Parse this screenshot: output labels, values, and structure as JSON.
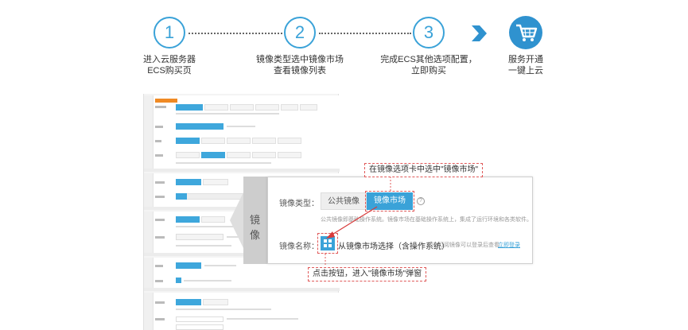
{
  "steps": [
    {
      "number": "1",
      "line1": "进入云服务器",
      "line2": "ECS购买页"
    },
    {
      "number": "2",
      "line1": "镜像类型选中镜像市场",
      "line2": "查看镜像列表"
    },
    {
      "number": "3",
      "line1": "完成ECS其他选项配置，",
      "line2": "立即购买"
    },
    {
      "number": "",
      "line1": "服务开通",
      "line2": "一键上云",
      "icon": "shopping-cart-icon"
    }
  ],
  "accent_color": "#3aa2d8",
  "callout": {
    "side_label": "镜像",
    "image_type_label": "镜像类型：",
    "tabs": [
      "公共镜像",
      "镜像市场"
    ],
    "selected_tab": "镜像市场",
    "help": "?",
    "desc": "公共镜像即基础操作系统。镜像市场在基础操作系统上，集成了运行环境和各类软件。",
    "image_name_label": "镜像名称：",
    "select_button_text": "从镜像市场选择（含操作系统）",
    "hint": "如有订阅镜像可以登录后查看",
    "login_link": "立即登录"
  },
  "annotations": {
    "tab_tip": "在镜像选项卡中选中\"镜像市场\"",
    "button_tip": "点击按钮，进入\"镜像市场\"弹窗",
    "color": "#e05a5a"
  }
}
